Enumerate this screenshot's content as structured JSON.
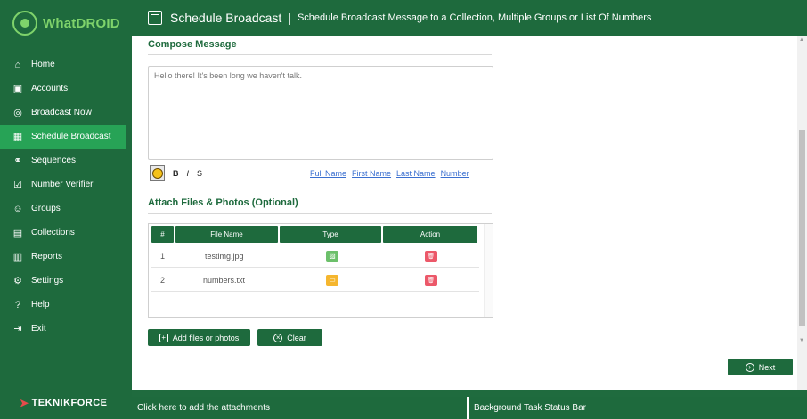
{
  "app": {
    "name": "WhatDROID",
    "brand": "TEKNIKFORCE"
  },
  "sidebar": {
    "items": [
      {
        "label": "Home",
        "icon": "home-icon"
      },
      {
        "label": "Accounts",
        "icon": "accounts-icon"
      },
      {
        "label": "Broadcast Now",
        "icon": "broadcast-icon"
      },
      {
        "label": "Schedule Broadcast",
        "icon": "calendar-icon",
        "active": true
      },
      {
        "label": "Sequences",
        "icon": "sequences-icon"
      },
      {
        "label": "Number Verifier",
        "icon": "verifier-icon"
      },
      {
        "label": "Groups",
        "icon": "groups-icon"
      },
      {
        "label": "Collections",
        "icon": "collections-icon"
      },
      {
        "label": "Reports",
        "icon": "reports-icon"
      },
      {
        "label": "Settings",
        "icon": "gear-icon"
      },
      {
        "label": "Help",
        "icon": "help-icon"
      },
      {
        "label": "Exit",
        "icon": "exit-icon"
      }
    ]
  },
  "header": {
    "title": "Schedule Broadcast",
    "separator": "|",
    "subtitle": "Schedule Broadcast Message to a Collection, Multiple Groups or List Of Numbers"
  },
  "compose": {
    "section_title": "Compose Message",
    "message": "Hello there! It's been long we haven't talk.",
    "format": {
      "bold": "B",
      "italic": "I",
      "strike": "S"
    },
    "placeholders": [
      "Full Name",
      "First Name",
      "Last Name",
      "Number"
    ]
  },
  "attachments": {
    "section_title": "Attach Files & Photos (Optional)",
    "columns": [
      "#",
      "File Name",
      "Type",
      "Action"
    ],
    "rows": [
      {
        "index": "1",
        "file_name": "testimg.jpg",
        "type": "image",
        "type_icon": "image-icon"
      },
      {
        "index": "2",
        "file_name": "numbers.txt",
        "type": "text",
        "type_icon": "folder-icon"
      }
    ],
    "add_label": "Add files or photos",
    "clear_label": "Clear"
  },
  "next_label": "Next",
  "status": {
    "left": "Click here to add the attachments",
    "right": "Background Task Status Bar"
  },
  "colors": {
    "primary": "#1e6a3d",
    "active": "#27a356",
    "image_type": "#6cc06a",
    "text_type": "#f5b62e",
    "delete": "#ec5869",
    "link": "#3a6fd0"
  }
}
